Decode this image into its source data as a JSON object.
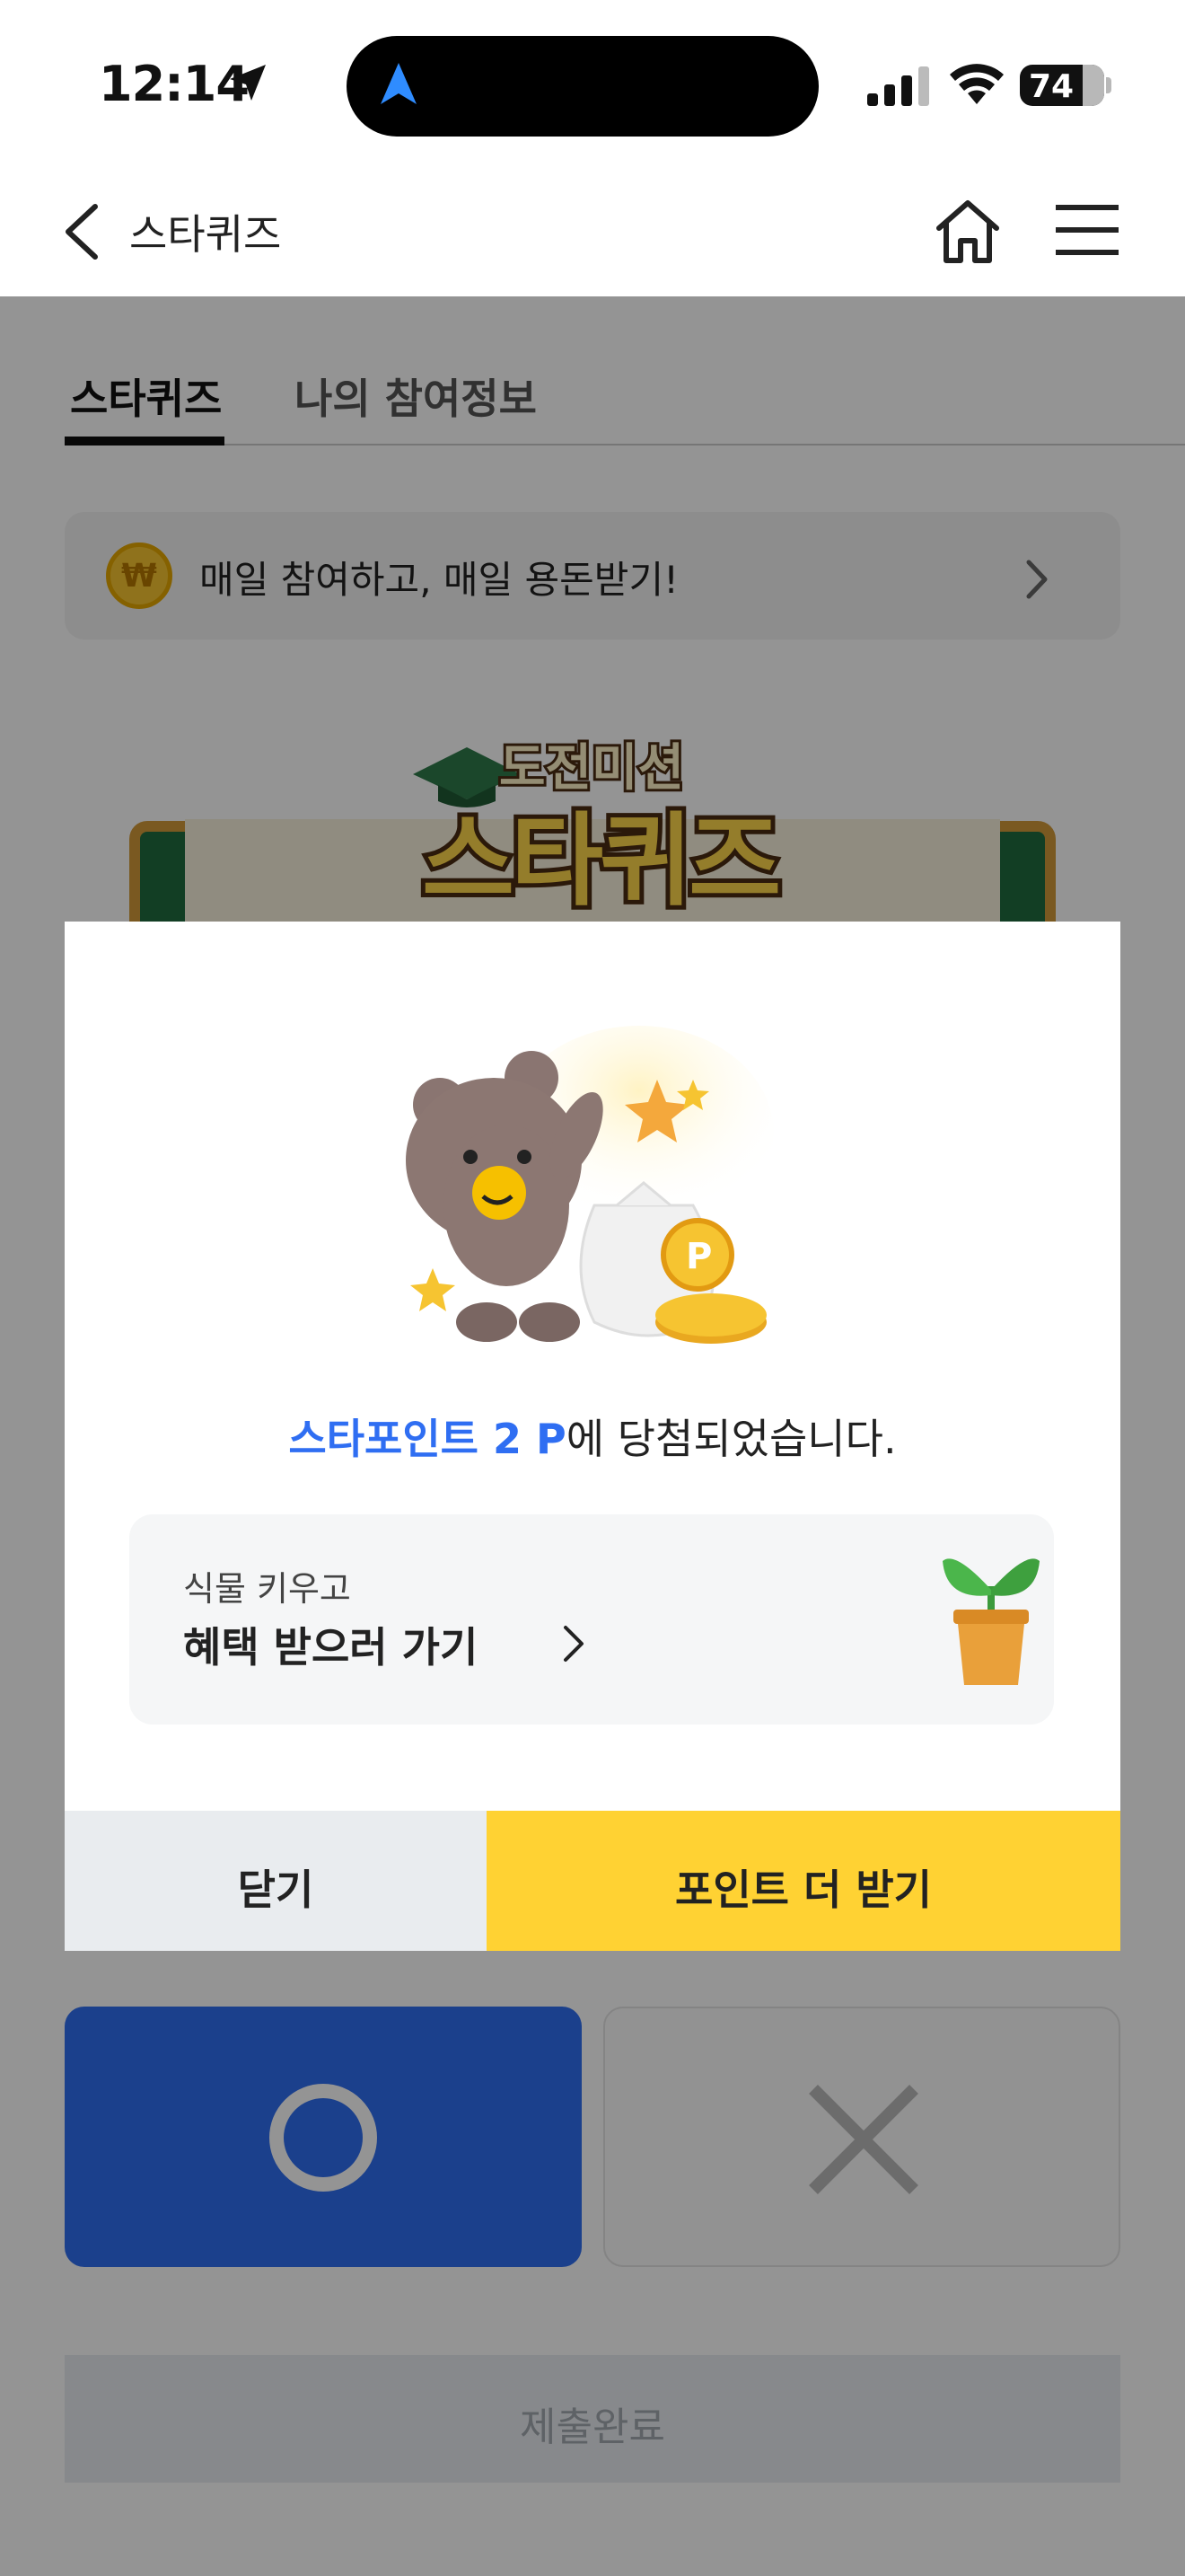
{
  "status_bar": {
    "time": "12:14",
    "battery": "74",
    "battery_level": 0.74
  },
  "header": {
    "title": "스타퀴즈"
  },
  "tabs": [
    {
      "label": "스타퀴즈",
      "active": true
    },
    {
      "label": "나의 참여정보",
      "active": false
    }
  ],
  "banner": {
    "icon": "₩",
    "text": "매일 참여하고, 매일 용돈받기!"
  },
  "quiz_logo": {
    "top": "도전미션",
    "main": "스타퀴즈"
  },
  "modal": {
    "highlight": "스타포인트 2 P",
    "message_rest": "에 당첨되었습니다.",
    "promo_sub": "식물 키우고",
    "promo_main": "혜택 받으러 가기",
    "close_label": "닫기",
    "more_label": "포인트 더 받기"
  },
  "answers": {
    "o_color": "#2f6ef2",
    "x_color": "#bbbbbb"
  },
  "submit_label": "제출완료",
  "colors": {
    "accent_blue": "#2f6ef2",
    "accent_yellow": "#ffd233"
  }
}
